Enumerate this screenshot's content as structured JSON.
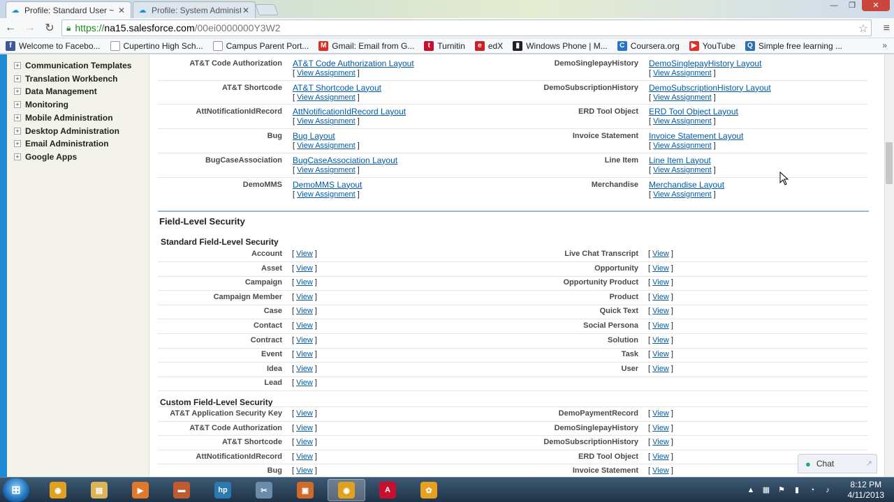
{
  "browser": {
    "tabs": [
      {
        "title": "Profile: Standard User ~ sa",
        "active": true
      },
      {
        "title": "Profile: System Administra",
        "active": false
      }
    ],
    "url": {
      "scheme": "https://",
      "host": "na15.salesforce.com",
      "path": "/00ei0000000Y3W2"
    },
    "bookmarks": [
      {
        "label": "Welcome to Facebo...",
        "icon": "facebook-icon",
        "color": "#3b5998",
        "glyph": "f"
      },
      {
        "label": "Cupertino High Sch...",
        "icon": "page-icon",
        "color": "#ffffff",
        "glyph": ""
      },
      {
        "label": "Campus Parent Port...",
        "icon": "globe-icon",
        "color": "#ffffff",
        "glyph": ""
      },
      {
        "label": "Gmail: Email from G...",
        "icon": "gmail-icon",
        "color": "#d93025",
        "glyph": "M"
      },
      {
        "label": "Turnitin",
        "icon": "turnitin-icon",
        "color": "#c8102e",
        "glyph": "t"
      },
      {
        "label": "edX",
        "icon": "edx-icon",
        "color": "#cc1f2a",
        "glyph": "e"
      },
      {
        "label": "Windows Phone | M...",
        "icon": "phone-icon",
        "color": "#222222",
        "glyph": "▮"
      },
      {
        "label": "Coursera.org",
        "icon": "coursera-icon",
        "color": "#2a73cc",
        "glyph": "C"
      },
      {
        "label": "YouTube",
        "icon": "youtube-icon",
        "color": "#e52d27",
        "glyph": "▶"
      },
      {
        "label": "Simple free learning ...",
        "icon": "quizlet-icon",
        "color": "#2d6fb7",
        "glyph": "Q"
      }
    ]
  },
  "sidebar": {
    "items": [
      "Communication Templates",
      "Translation Workbench",
      "Data Management",
      "Monitoring",
      "Mobile Administration",
      "Desktop Administration",
      "Email Administration",
      "Google Apps"
    ]
  },
  "layouts": {
    "view_assignment": "View Assignment",
    "left": [
      {
        "object": "AT&T Code Authorization",
        "layout": "AT&T Code Authorization Layout"
      },
      {
        "object": "AT&T Shortcode",
        "layout": "AT&T Shortcode Layout"
      },
      {
        "object": "AttNotificationIdRecord",
        "layout": "AttNotificationIdRecord Layout"
      },
      {
        "object": "Bug",
        "layout": "Bug Layout"
      },
      {
        "object": "BugCaseAssociation",
        "layout": "BugCaseAssociation Layout"
      },
      {
        "object": "DemoMMS",
        "layout": "DemoMMS Layout"
      }
    ],
    "right": [
      {
        "object": "DemoSinglepayHistory",
        "layout": "DemoSinglepayHistory Layout"
      },
      {
        "object": "DemoSubscriptionHistory",
        "layout": "DemoSubscriptionHistory Layout"
      },
      {
        "object": "ERD Tool Object",
        "layout": "ERD Tool Object Layout"
      },
      {
        "object": "Invoice Statement",
        "layout": "Invoice Statement Layout"
      },
      {
        "object": "Line Item",
        "layout": "Line Item Layout"
      },
      {
        "object": "Merchandise",
        "layout": "Merchandise Layout"
      }
    ]
  },
  "fls": {
    "title": "Field-Level Security",
    "view": "View",
    "standard_title": "Standard Field-Level Security",
    "standard_left": [
      "Account",
      "Asset",
      "Campaign",
      "Campaign Member",
      "Case",
      "Contact",
      "Contract",
      "Event",
      "Idea",
      "Lead"
    ],
    "standard_right": [
      "Live Chat Transcript",
      "Opportunity",
      "Opportunity Product",
      "Product",
      "Quick Text",
      "Social Persona",
      "Solution",
      "Task",
      "User"
    ],
    "custom_title": "Custom Field-Level Security",
    "custom_left": [
      "AT&T Application Security Key",
      "AT&T Code Authorization",
      "AT&T Shortcode",
      "AttNotificationIdRecord",
      "Bug"
    ],
    "custom_right": [
      "DemoPaymentRecord",
      "DemoSinglepayHistory",
      "DemoSubscriptionHistory",
      "ERD Tool Object",
      "Invoice Statement"
    ]
  },
  "chat": {
    "label": "Chat"
  },
  "taskbar": {
    "apps": [
      {
        "name": "chrome-icon",
        "color": "#e0a020",
        "glyph": "◉",
        "active": false
      },
      {
        "name": "folder-icon",
        "color": "#d9b45a",
        "glyph": "▤",
        "active": false
      },
      {
        "name": "media-player-icon",
        "color": "#e07a2a",
        "glyph": "▶",
        "active": false
      },
      {
        "name": "briefcase-icon",
        "color": "#c05a30",
        "glyph": "▬",
        "active": false
      },
      {
        "name": "hp-icon",
        "color": "#2a7ab0",
        "glyph": "hp",
        "active": false
      },
      {
        "name": "snipping-tool-icon",
        "color": "#6a8ca8",
        "glyph": "✂",
        "active": false
      },
      {
        "name": "package-icon",
        "color": "#d06a2a",
        "glyph": "▣",
        "active": false
      },
      {
        "name": "chrome-active-icon",
        "color": "#e0a020",
        "glyph": "◉",
        "active": true
      },
      {
        "name": "acrobat-icon",
        "color": "#c8102e",
        "glyph": "A",
        "active": false
      },
      {
        "name": "sunflower-icon",
        "color": "#e8a020",
        "glyph": "✿",
        "active": false
      }
    ],
    "time": "8:12 PM",
    "date": "4/11/2013"
  }
}
